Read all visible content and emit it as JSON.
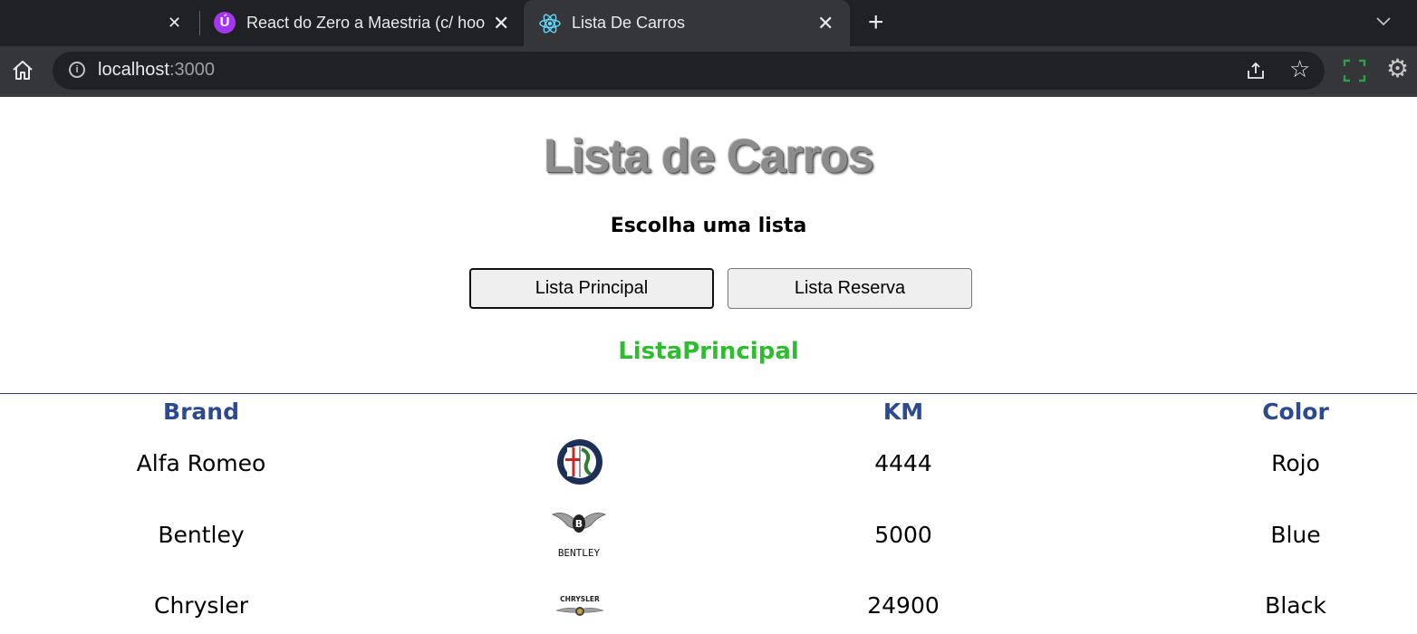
{
  "browser": {
    "tabs": [
      {
        "title": "React do Zero a Maestria (c/ hoo",
        "icon": "udemy-icon"
      },
      {
        "title": "Lista De Carros",
        "icon": "react-icon",
        "active": true
      }
    ],
    "url_host": "localhost",
    "url_port": ":3000"
  },
  "page": {
    "title": "Lista de Carros",
    "subtitle": "Escolha uma lista",
    "buttons": {
      "principal": "Lista Principal",
      "reserva": "Lista Reserva"
    },
    "active_list": "ListaPrincipal",
    "table": {
      "headers": [
        "Brand",
        "",
        "KM",
        "Color"
      ],
      "rows": [
        {
          "brand": "Alfa Romeo",
          "logo": "alfa-romeo-logo",
          "km": "4444",
          "color": "Rojo"
        },
        {
          "brand": "Bentley",
          "logo": "bentley-logo",
          "logo_text": "BENTLEY",
          "km": "5000",
          "color": "Blue"
        },
        {
          "brand": "Chrysler",
          "logo": "chrysler-logo",
          "logo_text": "CHRYSLER",
          "km": "24900",
          "color": "Black"
        }
      ]
    }
  },
  "colors": {
    "header_text": "#2e4a8f",
    "active_list": "#2ebd2e",
    "tabstrip": "#202124",
    "toolbar": "#35363a"
  }
}
